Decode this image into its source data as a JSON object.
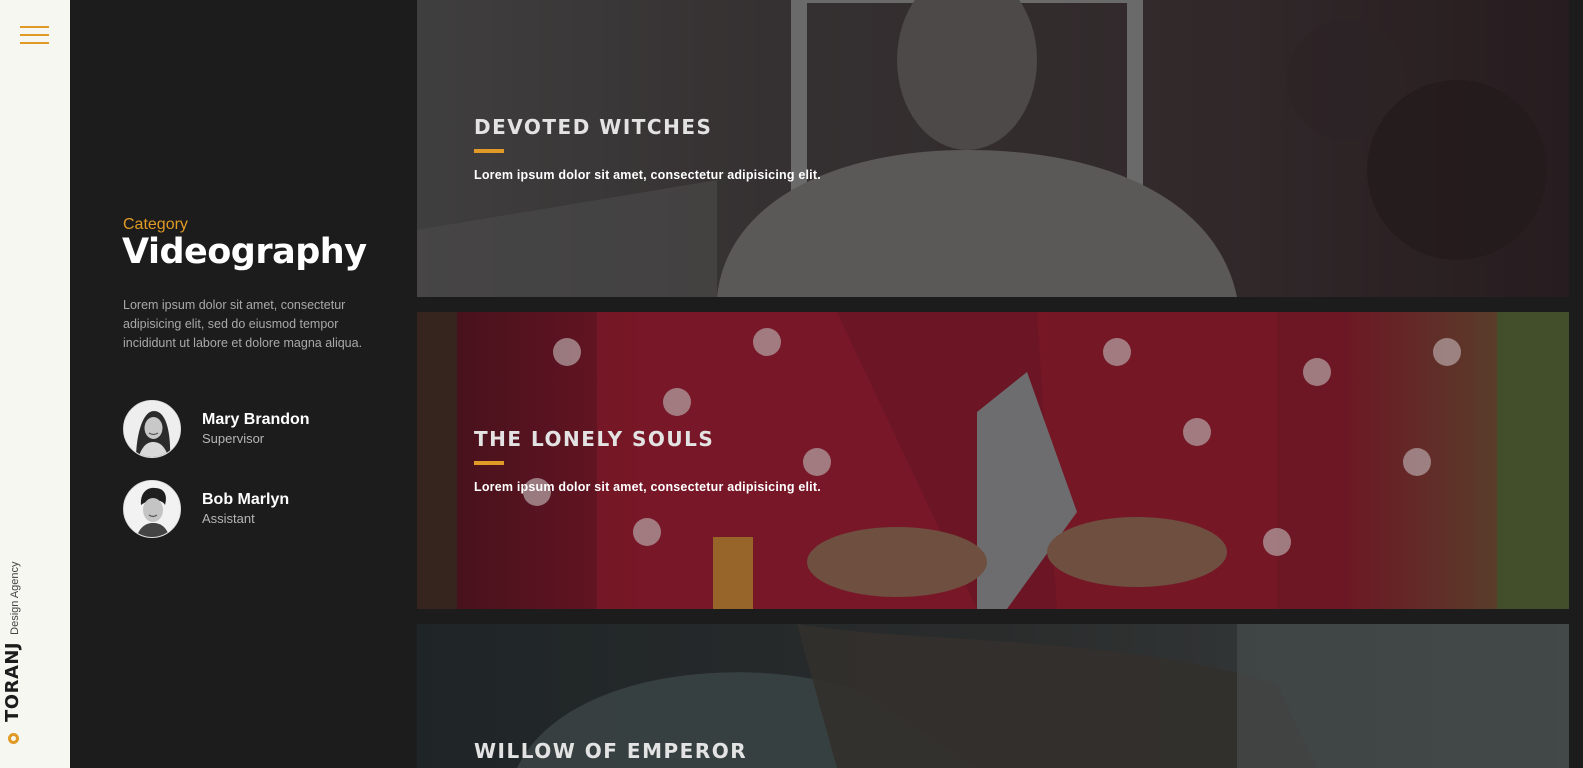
{
  "brand": {
    "name": "TORANJ",
    "tagline": "Design Agency",
    "accent": "#e09a25"
  },
  "menu": {
    "icon": "hamburger-menu-icon"
  },
  "category": {
    "label": "Category",
    "title": "Videography",
    "description": "Lorem ipsum dolor sit amet, consectetur adipisicing elit, sed do eiusmod tempor incididunt ut labore et dolore magna aliqua."
  },
  "team": [
    {
      "name": "Mary Brandon",
      "role": "Supervisor"
    },
    {
      "name": "Bob Marlyn",
      "role": "Assistant"
    }
  ],
  "projects": [
    {
      "title": "DEVOTED WITCHES",
      "text": "Lorem ipsum dolor sit amet, consectetur adipisicing elit."
    },
    {
      "title": "THE LONELY SOULS",
      "text": "Lorem ipsum dolor sit amet, consectetur adipisicing elit."
    },
    {
      "title": "WILLOW OF EMPEROR",
      "text": ""
    }
  ]
}
